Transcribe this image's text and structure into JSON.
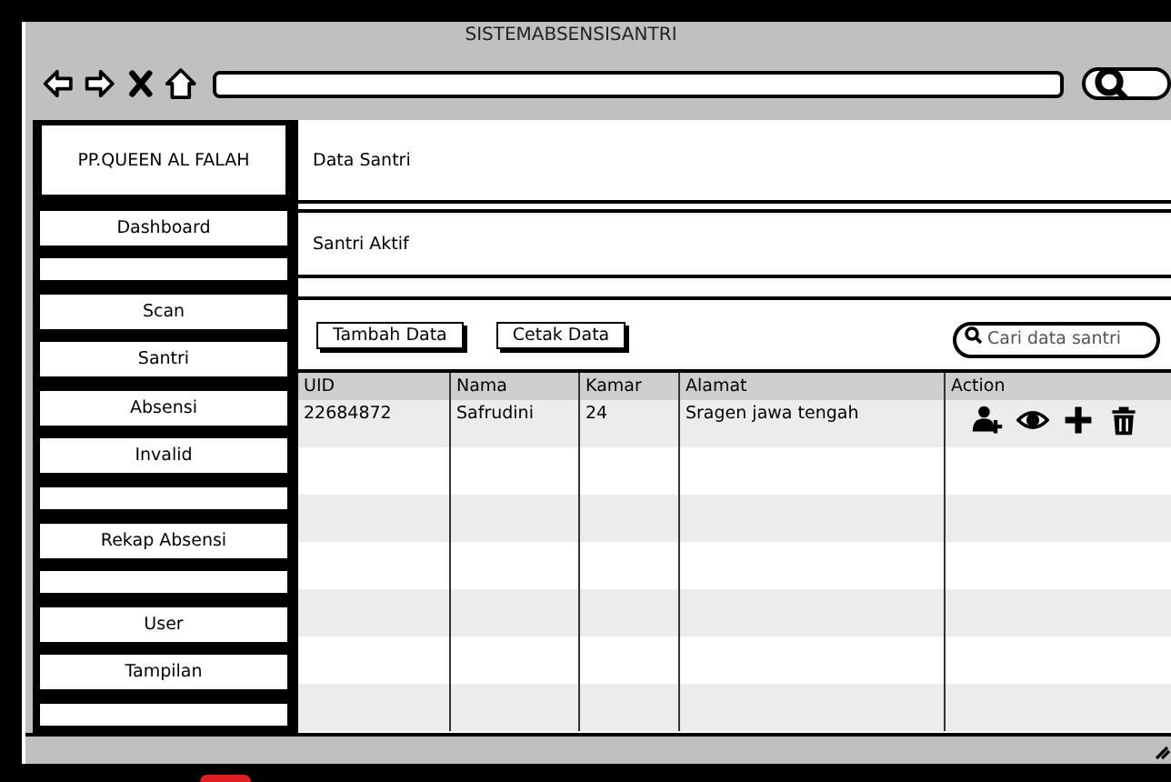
{
  "window": {
    "title": "SISTEMABSENSISANTRI"
  },
  "sidebar": {
    "header": "PP.QUEEN AL FALAH",
    "items": [
      {
        "kind": "link",
        "label": "Dashboard"
      },
      {
        "kind": "blank"
      },
      {
        "kind": "link",
        "label": "Scan"
      },
      {
        "kind": "link",
        "label": "Santri"
      },
      {
        "kind": "link",
        "label": "Absensi"
      },
      {
        "kind": "link",
        "label": "Invalid"
      },
      {
        "kind": "blank"
      },
      {
        "kind": "link",
        "label": "Rekap Absensi"
      },
      {
        "kind": "blank"
      },
      {
        "kind": "link",
        "label": "User"
      },
      {
        "kind": "link",
        "label": "Tampilan"
      },
      {
        "kind": "blank"
      }
    ]
  },
  "page_title": "Data Santri",
  "subtitle": "Santri Aktif",
  "buttons": [
    "Tambah Data",
    "Cetak Data"
  ],
  "search": {
    "placeholder": "Cari data santri"
  },
  "table": {
    "columns": [
      "UID",
      "Nama",
      "Kamar",
      "Alamat",
      "Action"
    ],
    "rows": [
      {
        "cells": [
          "22684872",
          "Safrudini",
          "24",
          "Sragen jawa tengah"
        ],
        "actions": [
          {
            "kind": "add-user"
          },
          {
            "kind": "view"
          },
          {
            "kind": "add"
          },
          {
            "kind": "delete"
          }
        ]
      }
    ]
  }
}
